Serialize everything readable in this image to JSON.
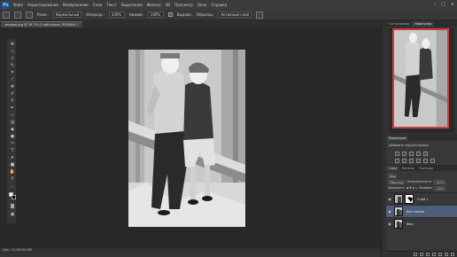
{
  "app": {
    "logo": "Ps"
  },
  "menu": [
    "Файл",
    "Редактирование",
    "Изображение",
    "Слои",
    "Текст",
    "Выделение",
    "Фильтр",
    "3D",
    "Просмотр",
    "Окно",
    "Справка"
  ],
  "window_controls": [
    "–",
    "□",
    "×"
  ],
  "options": {
    "size_label": "Разм.:",
    "size_value": "Нормальный",
    "opacity_label": "Непрозр.:",
    "opacity_value": "100%",
    "flow_label": "Нажим:",
    "flow_value": "100%",
    "aligned_label": "Выравн.",
    "sample_label": "Образец:",
    "sample_value": "Активный слой"
  },
  "document": {
    "tab_label": "zergibol.jpg @ 16,7% (Слой-копия, RGB/8#) *"
  },
  "status": {
    "doc_info": "Док: 20,2M/43,6M"
  },
  "panels": {
    "navigator_tabs": [
      "Гистограмма",
      "Навигатор"
    ],
    "adjustments_tab": "Коррекция",
    "adjustments_title": "Добавить корректировку",
    "layers_tabs": [
      "Слои",
      "Каналы",
      "Контуры"
    ],
    "kind_label": "Вид",
    "blend_mode": "Обычные",
    "opacity_label": "Непрозрачность:",
    "opacity_value": "100%",
    "lock_label": "Закрепить:",
    "fill_label": "Заливка:",
    "fill_value": "100%"
  },
  "layers": [
    {
      "name": "Слой 1",
      "visible": true,
      "selected": false,
      "has_mask": true
    },
    {
      "name": "Фон копия",
      "visible": true,
      "selected": true,
      "has_mask": false
    },
    {
      "name": "Фон",
      "visible": true,
      "selected": false,
      "has_mask": false
    }
  ],
  "colors": {
    "accent_selected": "#4d5e78",
    "navigator_frame": "#d23b3b",
    "ps_blue": "#1b4f8f"
  }
}
